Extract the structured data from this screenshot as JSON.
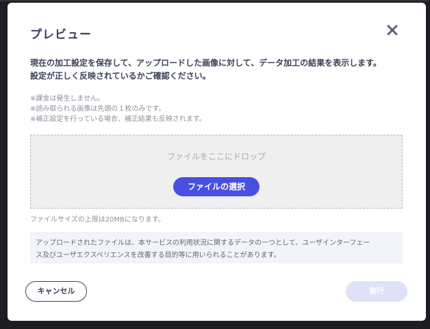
{
  "dialog": {
    "title": "プレビュー",
    "close_icon": "close-icon",
    "description": [
      "現在の加工設定を保存して、アップロードした画像に対して、データ加工の結果を表示します。",
      "設定が正しく反映されているかご確認ください。"
    ],
    "notes": [
      "※課金は発生しません。",
      "※読み取られる画像は先頭の１枚のみです。",
      "※補正設定を行っている場合、補正結果も反映されます。"
    ],
    "dropzone": {
      "text": "ファイルをここにドロップ",
      "select_button": "ファイルの選択"
    },
    "size_limit": "ファイルサイズの上限は20MBになります。",
    "info_text": [
      "アップロードされたファイルは、本サービスの利用状況に関するデータの一つとして、ユーザインターフェー",
      "ス及びユーザエクスペリエンスを改善する目的等に用いられることがあります。"
    ],
    "cancel_button": "キャンセル",
    "run_button": "実行"
  },
  "colors": {
    "accent": "#4a4fe0",
    "disabled_button": "#dfe1f7",
    "text": "#3b4057"
  }
}
